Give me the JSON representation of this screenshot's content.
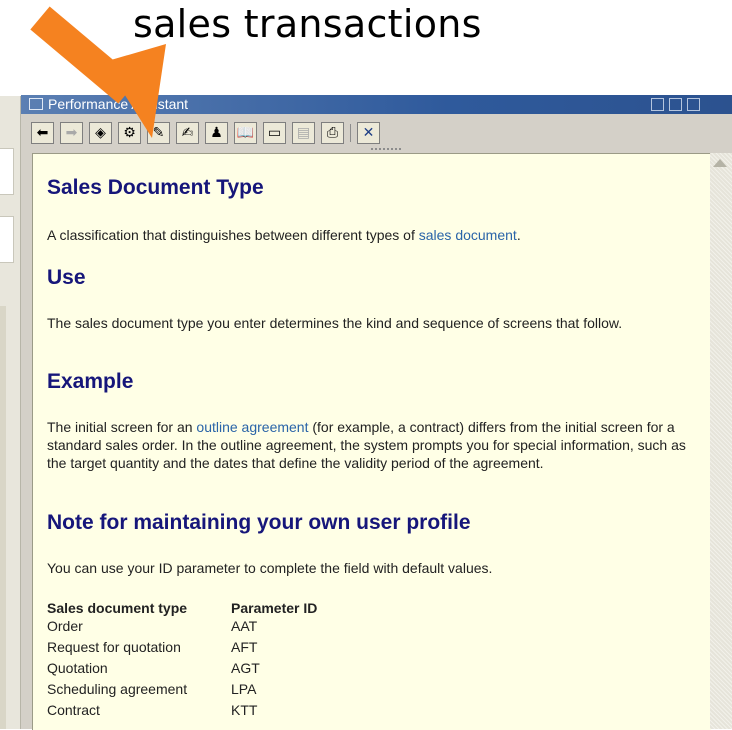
{
  "slide": {
    "title": "sales transactions"
  },
  "colors": {
    "arrow": "#f58220",
    "heading": "#16167a",
    "link": "#2a64a8",
    "content_bg": "#ffffe6",
    "titlebar": "#2f5a9c"
  },
  "window": {
    "title": "Performance Assistant",
    "controls": [
      "minimize-icon",
      "maximize-icon",
      "close-icon"
    ]
  },
  "toolbar": {
    "buttons": [
      {
        "icon": "back-arrow-icon",
        "glyph": "⬅"
      },
      {
        "icon": "forward-arrow-icon",
        "glyph": "➡",
        "disabled": true
      },
      {
        "icon": "eraser-icon",
        "glyph": "◈"
      },
      {
        "icon": "technical-info-icon",
        "glyph": "⚙"
      },
      {
        "icon": "edit-pencil-icon",
        "glyph": "✎"
      },
      {
        "icon": "note-icon",
        "glyph": "✍"
      },
      {
        "icon": "settings-person-icon",
        "glyph": "♟"
      },
      {
        "icon": "glossary-book-icon",
        "glyph": "📖"
      },
      {
        "icon": "window-icon",
        "glyph": "▭"
      },
      {
        "icon": "document-disabled-icon",
        "glyph": "▤",
        "disabled": true
      },
      {
        "icon": "print-icon",
        "glyph": "⎙"
      },
      {
        "icon": "exit-icon",
        "glyph": "✕"
      }
    ]
  },
  "doc": {
    "heading1": "Sales Document Type",
    "p1_text": "A classification that distinguishes between different types of ",
    "p1_link": "sales document",
    "p1_end": ".",
    "heading_use": "Use",
    "p_use": "The sales document type you enter determines the kind and sequence of screens that follow.",
    "heading_example": "Example",
    "p_example_1": "The initial screen for an ",
    "p_example_link": "outline agreement",
    "p_example_2": " (for example, a contract) differs from the initial screen for a standard sales order. In the outline agreement, the system prompts you for special information, such as the target quantity and the dates that define the validity period of the agreement.",
    "heading_note": "Note for maintaining your own user profile",
    "p_note": "You can use your ID parameter to complete the field with default values.",
    "table": {
      "headers": [
        "Sales document type",
        "Parameter ID"
      ],
      "rows": [
        [
          "Order",
          "AAT"
        ],
        [
          "Request for quotation",
          "AFT"
        ],
        [
          "Quotation",
          "AGT"
        ],
        [
          "Scheduling agreement",
          "LPA"
        ],
        [
          "Contract",
          "KTT"
        ]
      ]
    }
  }
}
